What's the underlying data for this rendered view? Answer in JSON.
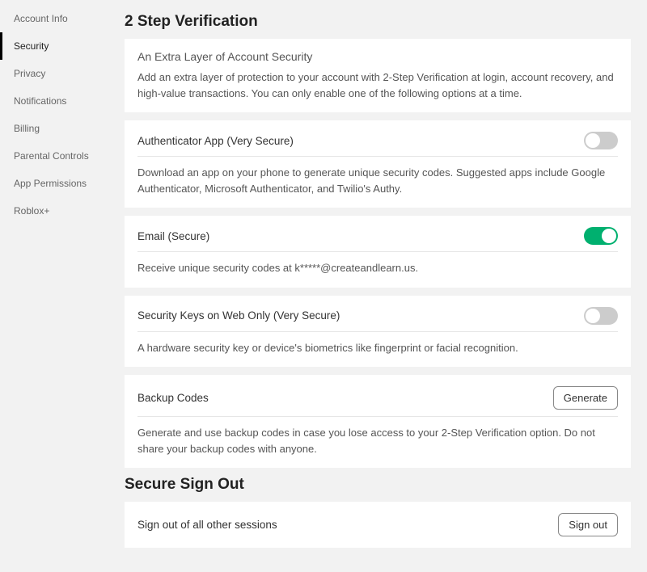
{
  "sidebar": {
    "items": [
      {
        "label": "Account Info"
      },
      {
        "label": "Security"
      },
      {
        "label": "Privacy"
      },
      {
        "label": "Notifications"
      },
      {
        "label": "Billing"
      },
      {
        "label": "Parental Controls"
      },
      {
        "label": "App Permissions"
      },
      {
        "label": "Roblox+"
      }
    ],
    "selected_index": 1
  },
  "section_2sv": {
    "title": "2 Step Verification",
    "intro_heading": "An Extra Layer of Account Security",
    "intro_body": "Add an extra layer of protection to your account with 2-Step Verification at login, account recovery, and high-value transactions. You can only enable one of the following options at a time.",
    "authenticator": {
      "label": "Authenticator App (Very Secure)",
      "desc": "Download an app on your phone to generate unique security codes. Suggested apps include Google Authenticator, Microsoft Authenticator, and Twilio's Authy.",
      "enabled": false
    },
    "email": {
      "label": "Email (Secure)",
      "desc": "Receive unique security codes at k*****@createandlearn.us.",
      "enabled": true
    },
    "security_keys": {
      "label": "Security Keys on Web Only (Very Secure)",
      "desc": "A hardware security key or device's biometrics like fingerprint or facial recognition.",
      "enabled": false
    },
    "backup": {
      "label": "Backup Codes",
      "button": "Generate",
      "desc": "Generate and use backup codes in case you lose access to your 2-Step Verification option. Do not share your backup codes with anyone."
    }
  },
  "section_signout": {
    "title": "Secure Sign Out",
    "row_label": "Sign out of all other sessions",
    "button": "Sign out"
  }
}
